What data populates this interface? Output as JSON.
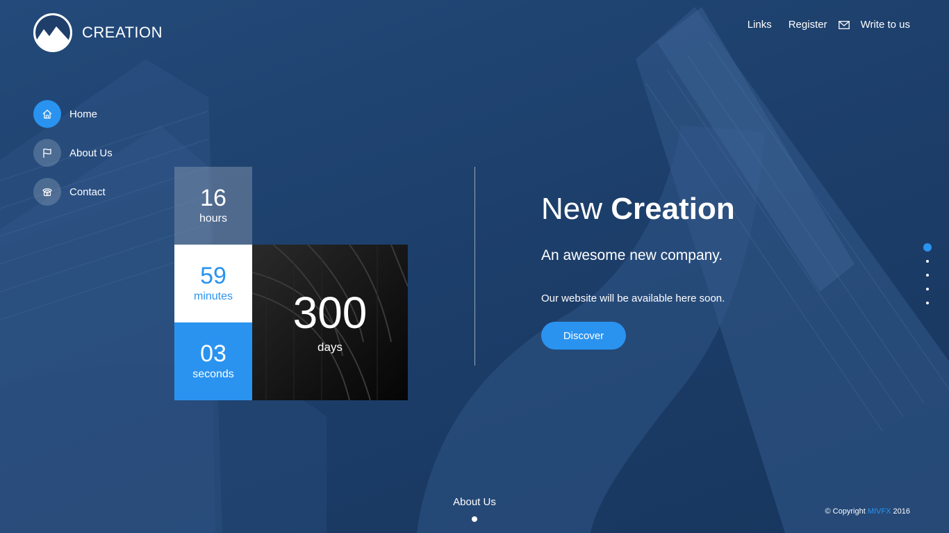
{
  "brand": {
    "name": "CREATION"
  },
  "topnav": {
    "links_label": "Links",
    "register_label": "Register",
    "write_label": "Write to us",
    "mail_icon": "envelope-icon"
  },
  "sidemenu": {
    "items": [
      {
        "label": "Home",
        "icon": "home-icon",
        "active": true
      },
      {
        "label": "About Us",
        "icon": "flag-icon",
        "active": false
      },
      {
        "label": "Contact",
        "icon": "phone-icon",
        "active": false
      }
    ]
  },
  "countdown": {
    "hours": {
      "value": "16",
      "unit": "hours"
    },
    "minutes": {
      "value": "59",
      "unit": "minutes"
    },
    "seconds": {
      "value": "03",
      "unit": "seconds"
    },
    "days": {
      "value": "300",
      "unit": "days"
    }
  },
  "hero": {
    "title_light": "New",
    "title_bold": "Creation",
    "subtitle": "An awesome new company.",
    "description": "Our website will be available here soon.",
    "cta_label": "Discover"
  },
  "section_dots": {
    "count": 5,
    "active_index": 0
  },
  "footer": {
    "next_section_label": "About Us",
    "copyright_prefix": "© Copyright",
    "copyright_brand": "MIVFX",
    "copyright_year": "2016"
  },
  "colors": {
    "accent": "#2a93f0",
    "background": "#1f3f6a",
    "text": "#ffffff"
  }
}
